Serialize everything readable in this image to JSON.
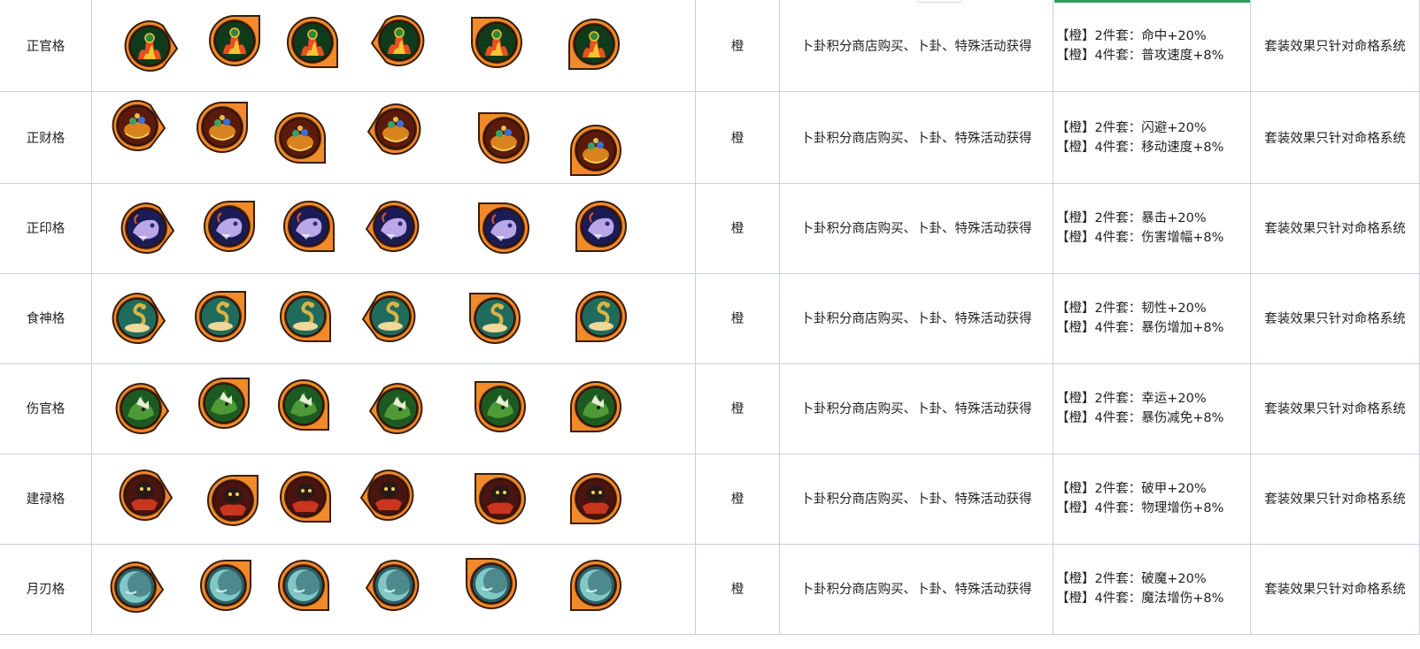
{
  "grade_label": "橙",
  "source_text": "卜卦积分商店购买、卜卦、特殊活动获得",
  "note_text": "套装效果只针对命格系统",
  "icon_variants": [
    "pointer-right-icon",
    "corner-top-right-icon",
    "corner-bottom-right-icon",
    "pointer-left-icon",
    "corner-top-left-icon",
    "corner-bottom-left-icon"
  ],
  "rows": [
    {
      "name": "正官格",
      "art": "flame-emblem",
      "colors": {
        "bg": "#0f3b1c",
        "art": "#e8501e",
        "accent": "#f4c531"
      },
      "effect_1": "【橙】2件套：命中+20%",
      "effect_2": "【橙】4件套：普攻速度+8%"
    },
    {
      "name": "正财格",
      "art": "treasure-emblem",
      "colors": {
        "bg": "#5a1a0c",
        "art": "#d9831f",
        "accent": "#3aa067"
      },
      "effect_1": "【橙】2件套：闪避+20%",
      "effect_2": "【橙】4件套：移动速度+8%"
    },
    {
      "name": "正印格",
      "art": "dragon-emblem",
      "colors": {
        "bg": "#1b1b55",
        "art": "#b9a7e8",
        "accent": "#e05a24"
      },
      "effect_1": "【橙】2件套：暴击+20%",
      "effect_2": "【橙】4件套：伤害增幅+8%"
    },
    {
      "name": "食神格",
      "art": "serpent-emblem",
      "colors": {
        "bg": "#1f6b5c",
        "art": "#f0d79a",
        "accent": "#d8b445"
      },
      "effect_1": "【橙】2件套：韧性+20%",
      "effect_2": "【橙】4件套：暴伤增加+8%"
    },
    {
      "name": "伤官格",
      "art": "beast-emblem",
      "colors": {
        "bg": "#1d5a22",
        "art": "#e8ecd8",
        "accent": "#4e9a36"
      },
      "effect_1": "【橙】2件套：幸运+20%",
      "effect_2": "【橙】4件套：暴伤减免+8%"
    },
    {
      "name": "建禄格",
      "art": "bag-emblem",
      "colors": {
        "bg": "#4a1410",
        "art": "#2a1a16",
        "accent": "#c9351e"
      },
      "effect_1": "【橙】2件套：破甲+20%",
      "effect_2": "【橙】4件套：物理增伤+8%"
    },
    {
      "name": "月刃格",
      "art": "moon-emblem",
      "colors": {
        "bg": "#2b5f67",
        "art": "#8fd9d6",
        "accent": "#c9eceb"
      },
      "effect_1": "【橙】2件套：破魔+20%",
      "effect_2": "【橙】4件套：魔法增伤+8%"
    }
  ],
  "frame_color": "#f08a2a",
  "border_color": "#c9cfdd",
  "selection_color": "#2e9e5b"
}
